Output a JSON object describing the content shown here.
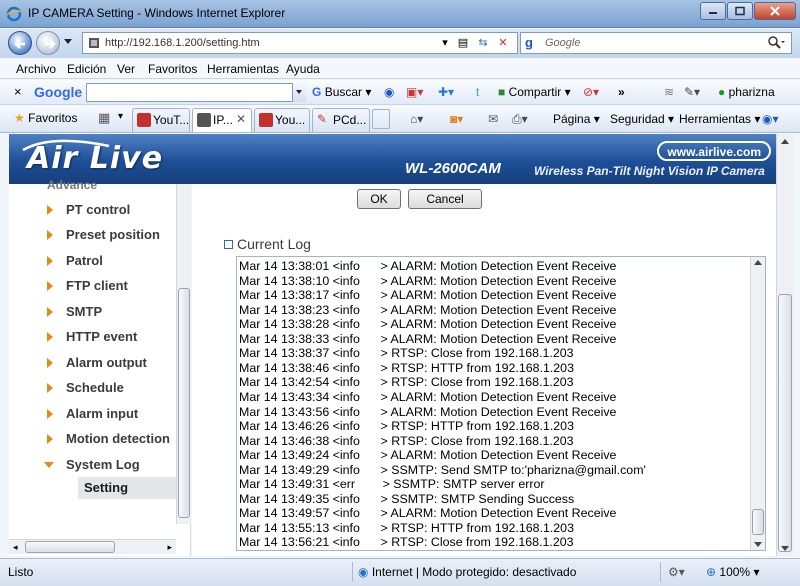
{
  "window": {
    "title": "IP CAMERA Setting - Windows Internet Explorer"
  },
  "address": {
    "url": "http://192.168.1.200/setting.htm",
    "search_placeholder": "Google"
  },
  "menu": [
    "Archivo",
    "Edición",
    "Ver",
    "Favoritos",
    "Herramientas",
    "Ayuda"
  ],
  "google_bar": {
    "logo": "Google",
    "search": "Buscar",
    "share": "Compartir",
    "user": "pharizna"
  },
  "favorites": {
    "label": "Favoritos"
  },
  "tabs": [
    {
      "label": "YouT...",
      "icon": "youtube-icon"
    },
    {
      "label": "IP...",
      "icon": "camera-page-icon"
    },
    {
      "label": "You...",
      "icon": "youtube-icon"
    },
    {
      "label": "PCd...",
      "icon": "tool-icon"
    }
  ],
  "commands": {
    "page": "Página",
    "security": "Seguridad",
    "tools": "Herramientas"
  },
  "banner": {
    "brand": "Air Live",
    "model": "WL-2600CAM",
    "tagline": "Wireless Pan-Tilt Night Vision IP Camera",
    "site": "www.airlive.com"
  },
  "sidebar": {
    "heading": "Advance",
    "items": [
      "PT control",
      "Preset position",
      "Patrol",
      "FTP client",
      "SMTP",
      "HTTP event",
      "Alarm output",
      "Schedule",
      "Alarm input",
      "Motion detection",
      "System Log"
    ],
    "subitem": "Setting"
  },
  "buttons": {
    "ok": "OK",
    "cancel": "Cancel"
  },
  "log": {
    "title": "Current Log",
    "lines": [
      "Mar 14 13:38:01 <info      > ALARM: Motion Detection Event Receive",
      "Mar 14 13:38:10 <info      > ALARM: Motion Detection Event Receive",
      "Mar 14 13:38:17 <info      > ALARM: Motion Detection Event Receive",
      "Mar 14 13:38:23 <info      > ALARM: Motion Detection Event Receive",
      "Mar 14 13:38:28 <info      > ALARM: Motion Detection Event Receive",
      "Mar 14 13:38:33 <info      > ALARM: Motion Detection Event Receive",
      "Mar 14 13:38:37 <info      > RTSP: Close from 192.168.1.203",
      "Mar 14 13:38:46 <info      > RTSP: HTTP from 192.168.1.203",
      "Mar 14 13:42:54 <info      > RTSP: Close from 192.168.1.203",
      "Mar 14 13:43:34 <info      > ALARM: Motion Detection Event Receive",
      "Mar 14 13:43:56 <info      > ALARM: Motion Detection Event Receive",
      "Mar 14 13:46:26 <info      > RTSP: HTTP from 192.168.1.203",
      "Mar 14 13:46:38 <info      > RTSP: Close from 192.168.1.203",
      "Mar 14 13:49:24 <info      > ALARM: Motion Detection Event Receive",
      "Mar 14 13:49:29 <info      > SSMTP: Send SMTP to:'pharizna@gmail.com'",
      "Mar 14 13:49:31 <err        > SSMTP: SMTP server error",
      "Mar 14 13:49:35 <info      > SSMTP: SMTP Sending Success",
      "Mar 14 13:49:57 <info      > ALARM: Motion Detection Event Receive",
      "Mar 14 13:55:13 <info      > RTSP: HTTP from 192.168.1.203",
      "Mar 14 13:56:21 <info      > RTSP: Close from 192.168.1.203"
    ]
  },
  "status": {
    "left": "Listo",
    "zone": "Internet | Modo protegido: desactivado",
    "zoom": "100%"
  },
  "colors": {
    "accent": "#1e4f96",
    "arrow": "#e78a15"
  }
}
